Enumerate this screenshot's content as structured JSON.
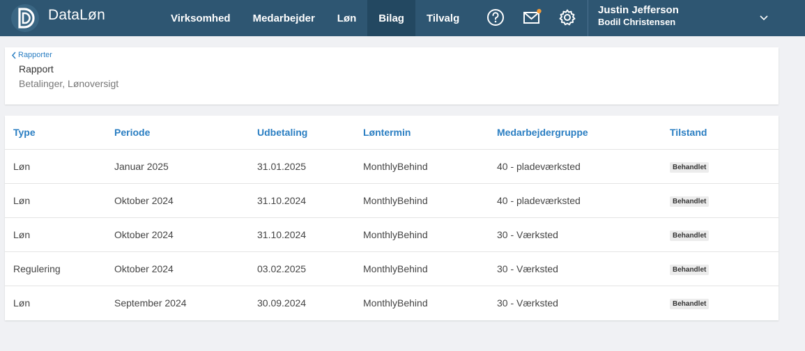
{
  "app": {
    "brand": "DataLøn"
  },
  "nav": [
    {
      "label": "Virksomhed",
      "active": false
    },
    {
      "label": "Medarbejder",
      "active": false
    },
    {
      "label": "Løn",
      "active": false
    },
    {
      "label": "Bilag",
      "active": true
    },
    {
      "label": "Tilvalg",
      "active": false
    }
  ],
  "icons": [
    "help-icon",
    "mail-icon",
    "settings-icon"
  ],
  "colors": {
    "topbar": "#2e5672",
    "accent": "#2a7ec2",
    "notification": "#f39c3a"
  },
  "user": {
    "name": "Justin Jefferson",
    "company": "Bodil Christensen"
  },
  "breadcrumb": {
    "back_label": "Rapporter"
  },
  "page": {
    "title": "Rapport",
    "subtitle": "Betalinger, Lønoversigt"
  },
  "table": {
    "columns": [
      "Type",
      "Periode",
      "Udbetaling",
      "Løntermin",
      "Medarbejdergruppe",
      "Tilstand"
    ],
    "rows": [
      [
        "Løn",
        "Januar 2025",
        "31.01.2025",
        "MonthlyBehind",
        "40 - pladeværksted",
        "Behandlet"
      ],
      [
        "Løn",
        "Oktober 2024",
        "31.10.2024",
        "MonthlyBehind",
        "40 - pladeværksted",
        "Behandlet"
      ],
      [
        "Løn",
        "Oktober 2024",
        "31.10.2024",
        "MonthlyBehind",
        "30 - Værksted",
        "Behandlet"
      ],
      [
        "Regulering",
        "Oktober 2024",
        "03.02.2025",
        "MonthlyBehind",
        "30 - Værksted",
        "Behandlet"
      ],
      [
        "Løn",
        "September 2024",
        "30.09.2024",
        "MonthlyBehind",
        "30 - Værksted",
        "Behandlet"
      ]
    ]
  }
}
